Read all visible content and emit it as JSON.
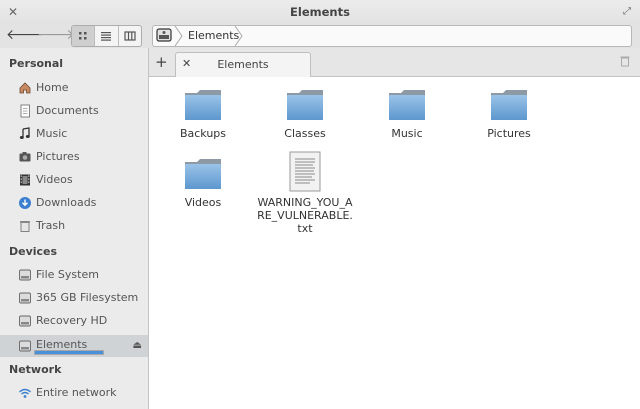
{
  "window": {
    "title": "Elements"
  },
  "location": {
    "crumb": "Elements"
  },
  "tabs": [
    {
      "label": "Elements"
    }
  ],
  "sidebar": {
    "sections": [
      {
        "heading": "Personal",
        "items": [
          {
            "label": "Home",
            "icon": "home-icon"
          },
          {
            "label": "Documents",
            "icon": "document-icon"
          },
          {
            "label": "Music",
            "icon": "music-note-icon"
          },
          {
            "label": "Pictures",
            "icon": "camera-icon"
          },
          {
            "label": "Videos",
            "icon": "film-icon"
          },
          {
            "label": "Downloads",
            "icon": "download-icon"
          },
          {
            "label": "Trash",
            "icon": "trash-icon"
          }
        ]
      },
      {
        "heading": "Devices",
        "items": [
          {
            "label": "File System",
            "icon": "drive-icon"
          },
          {
            "label": "365 GB Filesystem",
            "icon": "drive-icon"
          },
          {
            "label": "Recovery HD",
            "icon": "drive-icon"
          },
          {
            "label": "Elements",
            "icon": "drive-icon",
            "selected": true
          }
        ]
      },
      {
        "heading": "Network",
        "items": [
          {
            "label": "Entire network",
            "icon": "network-icon"
          }
        ]
      }
    ]
  },
  "files": [
    {
      "name": "Backups",
      "type": "folder"
    },
    {
      "name": "Classes",
      "type": "folder"
    },
    {
      "name": "Music",
      "type": "folder"
    },
    {
      "name": "Pictures",
      "type": "folder"
    },
    {
      "name": "Videos",
      "type": "folder"
    },
    {
      "name": "WARNING_YOU_ARE_VULNERABLE.txt",
      "type": "text"
    }
  ],
  "colors": {
    "accent": "#4a90d9",
    "folder": "#6aa5d8",
    "sidebar_bg": "#ebebeb"
  }
}
